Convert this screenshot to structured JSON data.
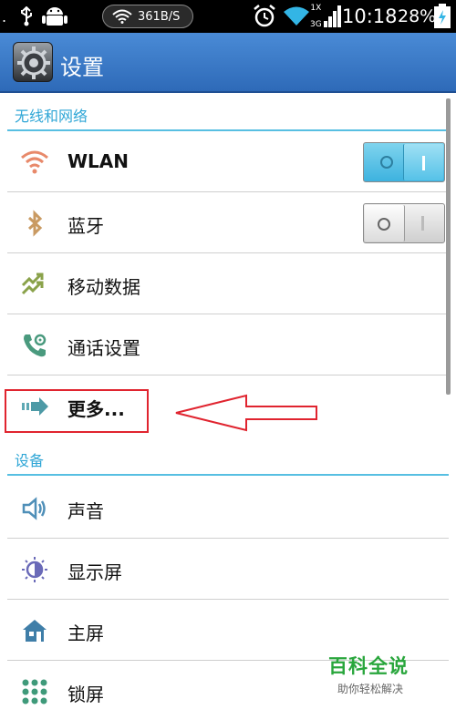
{
  "status_bar": {
    "dot": ".",
    "speed": "361B/S",
    "network_type": "3G",
    "network_small": "1X",
    "time": "10:18",
    "battery": "28%",
    "icons": [
      "usb-icon",
      "android-icon",
      "wifi-icon",
      "alarm-icon",
      "signal-icon",
      "battery-icon"
    ]
  },
  "title_bar": {
    "title": "设置",
    "icon": "settings-gear-icon"
  },
  "sections": {
    "wireless": {
      "header": "无线和网络",
      "items": [
        {
          "label": "WLAN",
          "icon": "wifi-icon",
          "toggle": "on"
        },
        {
          "label": "蓝牙",
          "icon": "bluetooth-icon",
          "toggle": "off"
        },
        {
          "label": "移动数据",
          "icon": "mobile-data-icon"
        },
        {
          "label": "通话设置",
          "icon": "call-settings-icon"
        },
        {
          "label": "更多...",
          "icon": "more-arrow-icon"
        }
      ]
    },
    "device": {
      "header": "设备",
      "items": [
        {
          "label": "声音",
          "icon": "speaker-icon"
        },
        {
          "label": "显示屏",
          "icon": "brightness-icon"
        },
        {
          "label": "主屏",
          "icon": "home-icon"
        },
        {
          "label": "锁屏",
          "icon": "lock-screen-icon"
        }
      ]
    }
  },
  "watermark": {
    "title": "百科全说",
    "subtitle": "助你轻松解决"
  },
  "colors": {
    "title_bar": "#3a7cc8",
    "section_accent": "#2fa6d6",
    "highlight": "#e0242f",
    "watermark": "#29a63c"
  }
}
